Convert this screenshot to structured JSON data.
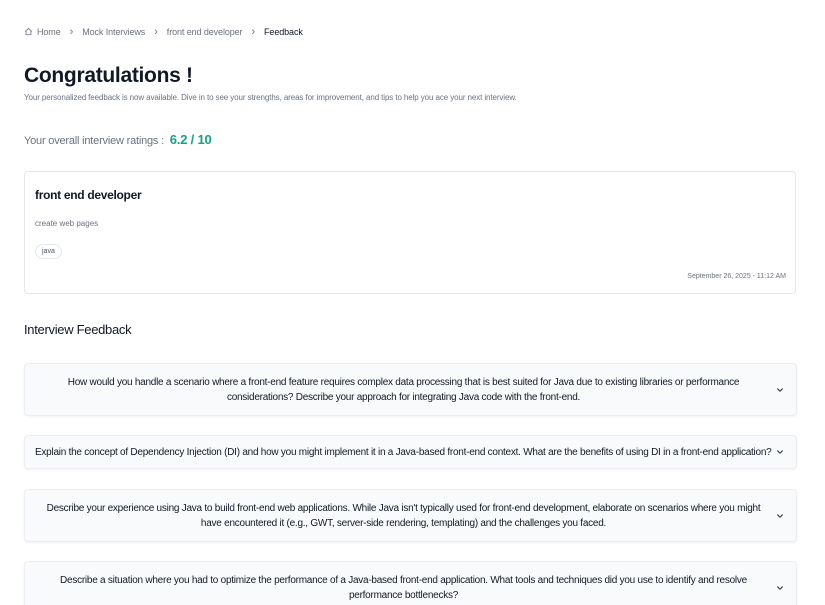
{
  "breadcrumb": {
    "items": [
      {
        "label": "Home",
        "icon": "home-icon"
      },
      {
        "label": "Mock Interviews"
      },
      {
        "label": "front end developer"
      },
      {
        "label": "Feedback"
      }
    ],
    "separator_icon": "chevron-right-icon"
  },
  "header": {
    "title": "Congratulations !",
    "subtitle": "Your personalized feedback is now available. Dive in to see your strengths, areas for improvement, and tips to help you ace your next interview."
  },
  "rating": {
    "label": "Your overall interview ratings :",
    "value": "6.2 / 10",
    "score": 6.2,
    "max": 10,
    "color": "#16a085"
  },
  "interview": {
    "title": "front end developer",
    "description": "create web pages",
    "tags": [
      "java"
    ],
    "date": "September 26, 2025 - 11:12 AM"
  },
  "feedback": {
    "section_title": "Interview Feedback",
    "questions": [
      {
        "text": "How would you handle a scenario where a front-end feature requires complex data processing that is best suited for Java due to existing libraries or performance considerations? Describe your approach for integrating Java code with the front-end.",
        "expanded": false
      },
      {
        "text": "Explain the concept of Dependency Injection (DI) and how you might implement it in a Java-based front-end context. What are the benefits of using DI in a front-end application?",
        "expanded": false
      },
      {
        "text": "Describe your experience using Java to build front-end web applications. While Java isn't typically used for front-end development, elaborate on scenarios where you might have encountered it (e.g., GWT, server-side rendering, templating) and the challenges you faced.",
        "expanded": false
      },
      {
        "text": "Describe a situation where you had to optimize the performance of a Java-based front-end application. What tools and techniques did you use to identify and resolve performance bottlenecks?",
        "expanded": false
      }
    ],
    "toggle_icon": "chevron-down-icon"
  }
}
